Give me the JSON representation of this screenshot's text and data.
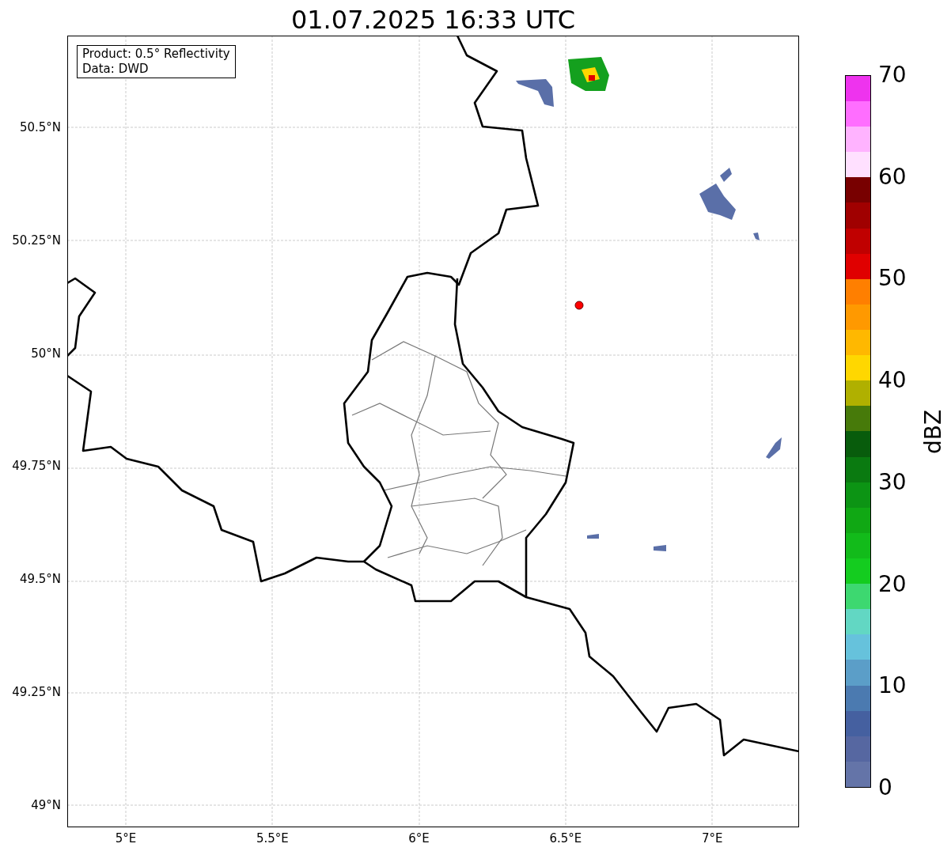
{
  "title": "01.07.2025 16:33 UTC",
  "info_box": [
    "Product: 0.5° Reflectivity",
    "Data: DWD"
  ],
  "lat_ticks": [
    "50.5°N",
    "50.25°N",
    "50°N",
    "49.75°N",
    "49.5°N",
    "49.25°N",
    "49°N"
  ],
  "lon_ticks": [
    "5°E",
    "5.5°E",
    "6°E",
    "6.5°E",
    "7°E"
  ],
  "colorbar": {
    "label": "dBZ",
    "ticks": [
      "70",
      "60",
      "50",
      "40",
      "30",
      "20",
      "10",
      "0"
    ],
    "bins": [
      {
        "color": "#6474a8"
      },
      {
        "color": "#5667a1"
      },
      {
        "color": "#4560a0"
      },
      {
        "color": "#4b7ab0"
      },
      {
        "color": "#5b9ec8"
      },
      {
        "color": "#66c2dc"
      },
      {
        "color": "#62d7c3"
      },
      {
        "color": "#3dd870"
      },
      {
        "color": "#14cc1f"
      },
      {
        "color": "#12bb1a"
      },
      {
        "color": "#10a814"
      },
      {
        "color": "#0c9414"
      },
      {
        "color": "#0a7a10"
      },
      {
        "color": "#085c0c"
      },
      {
        "color": "#477a0a"
      },
      {
        "color": "#b0b000"
      },
      {
        "color": "#ffd700"
      },
      {
        "color": "#ffb800"
      },
      {
        "color": "#ff9900"
      },
      {
        "color": "#ff7f00"
      },
      {
        "color": "#e00000"
      },
      {
        "color": "#c00000"
      },
      {
        "color": "#a00000"
      },
      {
        "color": "#780000"
      },
      {
        "color": "#ffe0ff"
      },
      {
        "color": "#ffb3ff"
      },
      {
        "color": "#ff6eff"
      },
      {
        "color": "#ee33ee"
      }
    ]
  }
}
